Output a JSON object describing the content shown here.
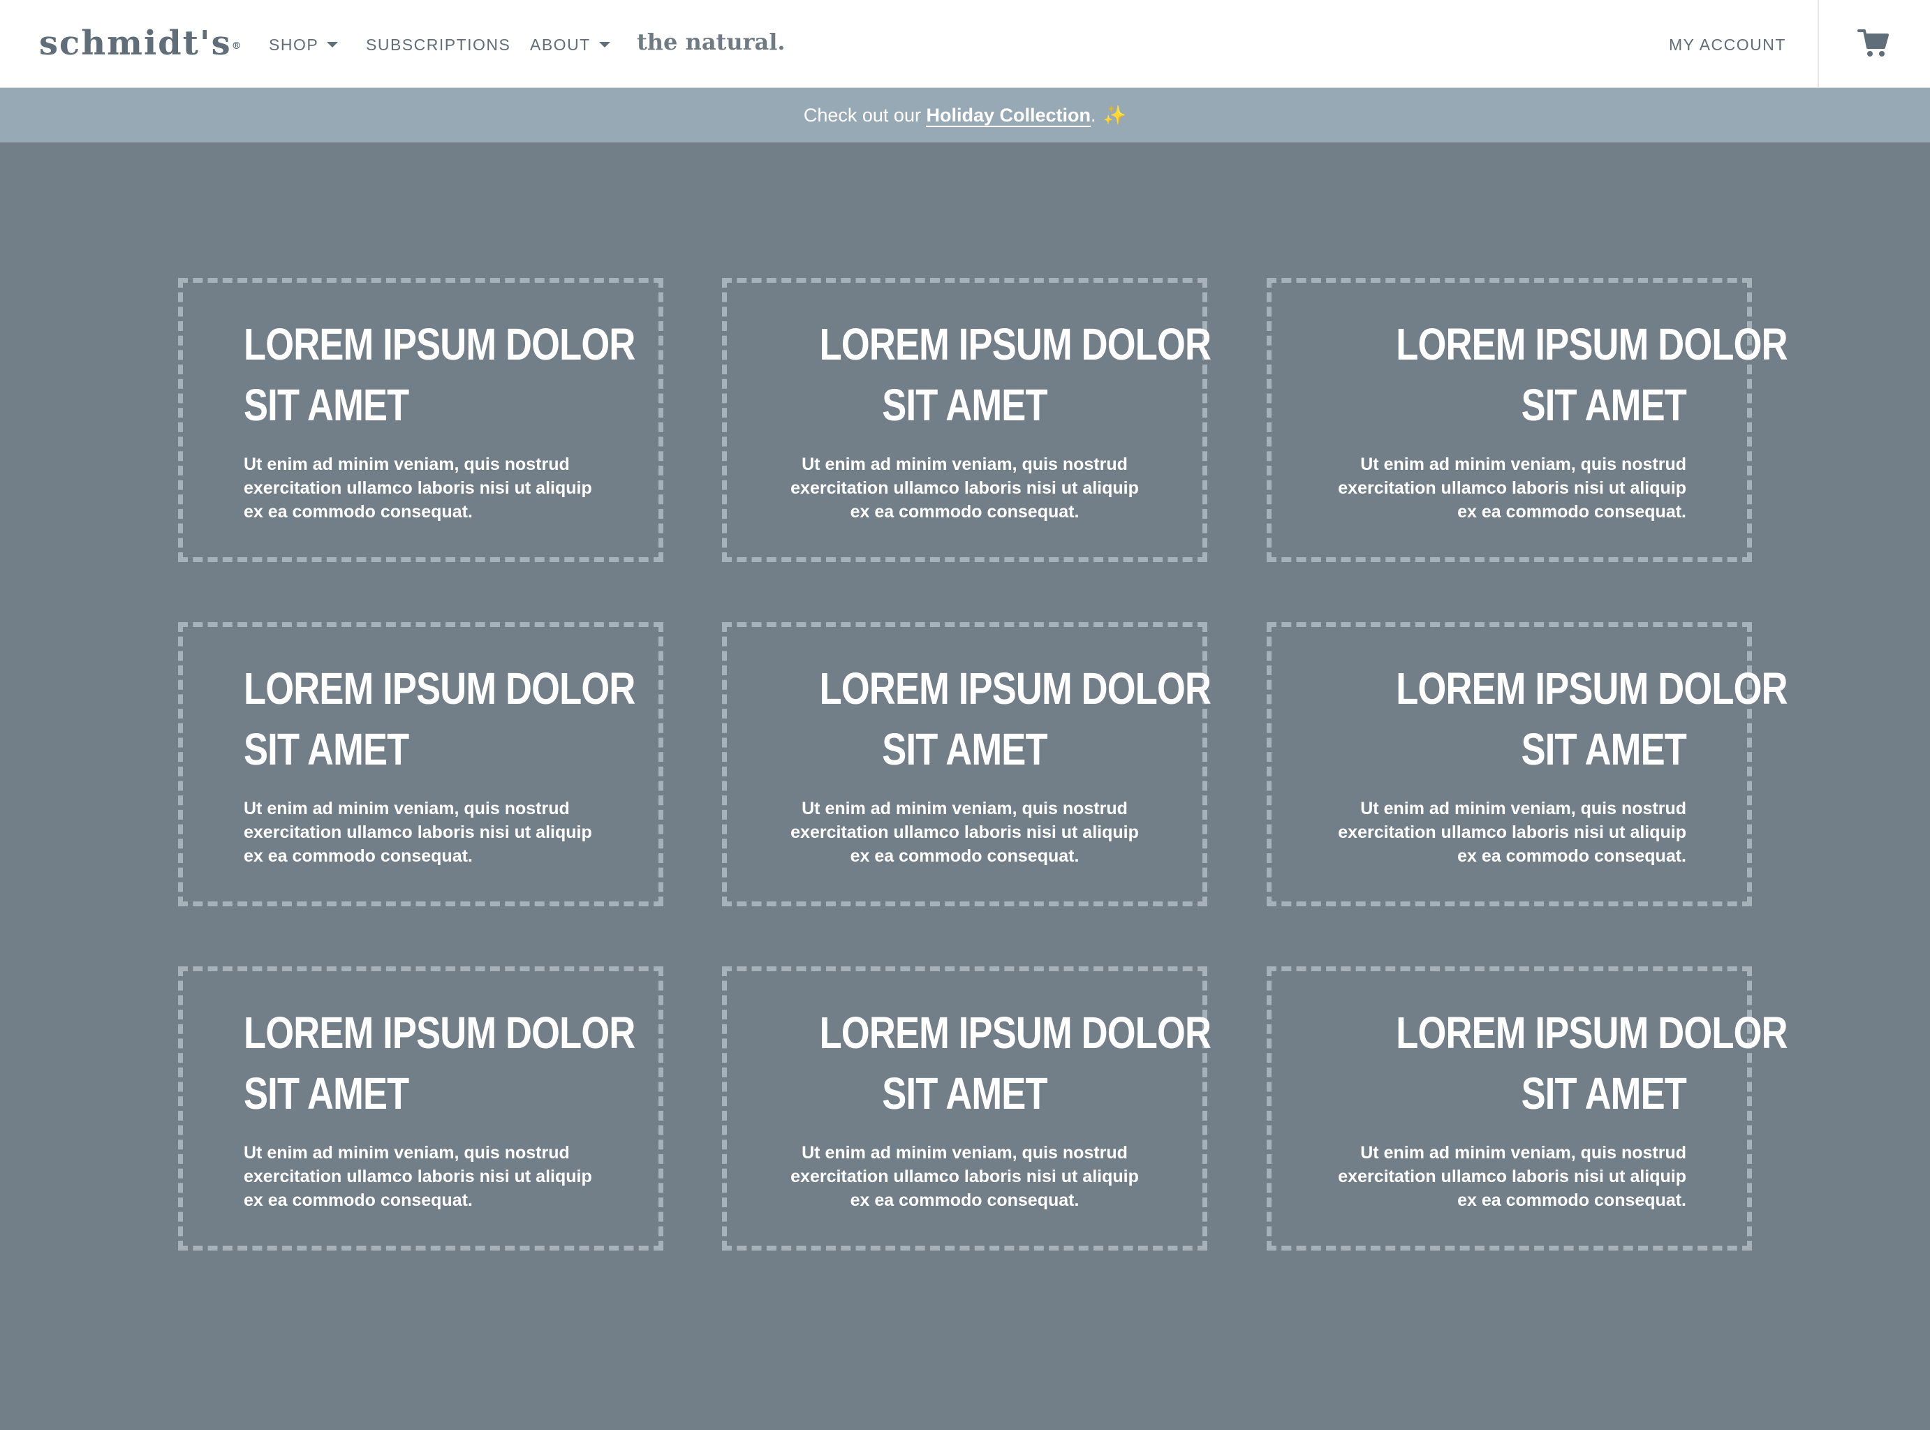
{
  "header": {
    "logo": "schmidt's",
    "logo_mark": "®",
    "nav": [
      {
        "label": "SHOP",
        "has_dropdown": true
      },
      {
        "label": "SUBSCRIPTIONS",
        "has_dropdown": false
      },
      {
        "label": "ABOUT",
        "has_dropdown": true
      }
    ],
    "natural": "the natural.",
    "account": "MY ACCOUNT",
    "cart_icon": "shopping-cart-icon"
  },
  "banner": {
    "prefix": "Check out our ",
    "link": "Holiday Collection",
    "suffix": ".",
    "emoji": "✨"
  },
  "cards": [
    {
      "title_line1": "LOREM IPSUM DOLOR",
      "title_line2": "SIT AMET",
      "text": "Ut enim ad minim veniam, quis nostrud exercitation ullamco laboris nisi ut aliquip ex ea commodo consequat.",
      "align": "left"
    },
    {
      "title_line1": "LOREM IPSUM DOLOR",
      "title_line2": "SIT AMET",
      "text": "Ut enim ad minim veniam, quis nostrud exercitation ullamco laboris nisi ut aliquip ex ea commodo consequat.",
      "align": "center"
    },
    {
      "title_line1": "LOREM IPSUM DOLOR",
      "title_line2": "SIT AMET",
      "text": "Ut enim ad minim veniam, quis nostrud exercitation ullamco laboris nisi ut aliquip ex ea commodo consequat.",
      "align": "right"
    },
    {
      "title_line1": "LOREM IPSUM DOLOR",
      "title_line2": "SIT AMET",
      "text": "Ut enim ad minim veniam, quis nostrud exercitation ullamco laboris nisi ut aliquip ex ea commodo consequat.",
      "align": "left"
    },
    {
      "title_line1": "LOREM IPSUM DOLOR",
      "title_line2": "SIT AMET",
      "text": "Ut enim ad minim veniam, quis nostrud exercitation ullamco laboris nisi ut aliquip ex ea commodo consequat.",
      "align": "center"
    },
    {
      "title_line1": "LOREM IPSUM DOLOR",
      "title_line2": "SIT AMET",
      "text": "Ut enim ad minim veniam, quis nostrud exercitation ullamco laboris nisi ut aliquip ex ea commodo consequat.",
      "align": "right"
    },
    {
      "title_line1": "LOREM IPSUM DOLOR",
      "title_line2": "SIT AMET",
      "text": "Ut enim ad minim veniam, quis nostrud exercitation ullamco laboris nisi ut aliquip ex ea commodo consequat.",
      "align": "left"
    },
    {
      "title_line1": "LOREM IPSUM DOLOR",
      "title_line2": "SIT AMET",
      "text": "Ut enim ad minim veniam, quis nostrud exercitation ullamco laboris nisi ut aliquip ex ea commodo consequat.",
      "align": "center"
    },
    {
      "title_line1": "LOREM IPSUM DOLOR",
      "title_line2": "SIT AMET",
      "text": "Ut enim ad minim veniam, quis nostrud exercitation ullamco laboris nisi ut aliquip ex ea commodo consequat.",
      "align": "right"
    }
  ],
  "colors": {
    "page_background": "#727f89",
    "banner_background": "#98a9b6",
    "header_text": "#5f6e78",
    "card_border": "#a6b1b9"
  }
}
